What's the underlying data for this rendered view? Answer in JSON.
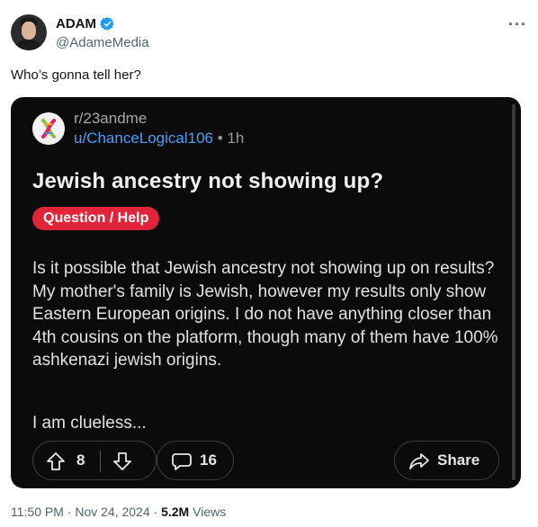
{
  "author": {
    "name": "ADAM",
    "handle": "@AdameMedia",
    "verified_color": "#1d9bf0",
    "avatar_icon": "avatar-photo"
  },
  "more_icon": "more-dots-icon",
  "tweet": {
    "text": "Who’s gonna tell her?"
  },
  "embed": {
    "subreddit": "r/23andme",
    "username": "u/ChanceLogical106",
    "separator": "•",
    "time": "1h",
    "title": "Jewish ancestry not showing up?",
    "flair": "Question / Help",
    "flair_color": "#e0253a",
    "body": "Is it possible that Jewish ancestry not showing up on results? My mother's family is Jewish, however   my results only show Eastern European origins. I do not have anything closer than 4th cousins on the platform, though many of them have 100% ashkenazi jewish origins.",
    "body2": "I am clueless...",
    "votes": "8",
    "comments": "16",
    "share_label": "Share"
  },
  "meta": {
    "time": "11:50 PM",
    "sep1": "·",
    "date": "Nov 24, 2024",
    "sep2": "·",
    "views_count": "5.2M",
    "views_label": "Views"
  }
}
